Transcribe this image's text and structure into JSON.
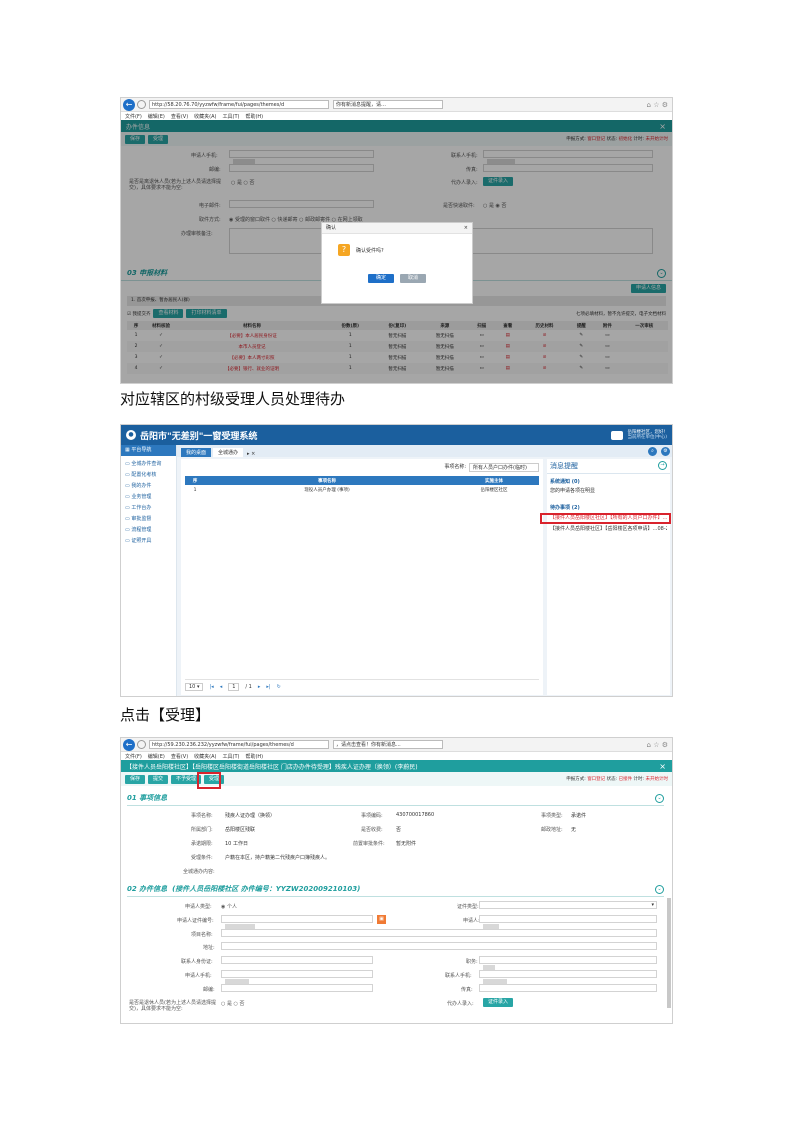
{
  "screen1": {
    "url": "http://58.20.76.70/yyzwfw/frame/fui/pages/themes/d",
    "tab_title": "你有新消息提醒，请…",
    "menu": [
      "文件(F)",
      "编辑(E)",
      "查看(V)",
      "收藏夹(A)",
      "工具(T)",
      "帮助(H)"
    ],
    "window_title": "办件信息",
    "close": "×",
    "buttons": [
      "保存",
      "受理"
    ],
    "status": {
      "label_method": "申报方式:",
      "method": "窗口登记",
      "label_state": "状态:",
      "state": "初始化",
      "label_timer": "计时:",
      "timer": "未开始计时"
    },
    "form_labels": {
      "mobile": "申请人手机:",
      "postal": "邮编:",
      "is_pension": "是否是离退休人员(若为上述人员请选择提交)，具体要求不能为空:",
      "yes": "是",
      "no": "否",
      "email": "电子邮件:",
      "pickup": "取件方式:",
      "pickup_options": [
        "受理的窗口取件",
        "快递邮寄",
        "邮政邮寄件",
        "在网上领取"
      ],
      "remark": "办理审核备注:",
      "contact_mobile": "联系人手机:",
      "fax": "传真:",
      "agent_entry": "代办人录入:",
      "agent_btn": "证件录入",
      "express": "是否快递取件:",
      "express_yes": "是",
      "express_no": "否"
    },
    "dialog": {
      "title": "确认",
      "message": "确认受件吗?",
      "ok": "确定",
      "cancel": "取消"
    },
    "section_title": "03 申报材料",
    "right_btn": "申请人信息",
    "material_group": "1. 首次申报、暂办居民人(群)",
    "toolbar": {
      "check_all": "我提交齐",
      "scan_btn": "查看材料",
      "print_btn": "打印材料清单",
      "note": "七项必填材料，暂不允许提交，电子文档材料"
    },
    "columns": [
      "序",
      "材料核验",
      "材料名称",
      "份数(原)",
      "份(复印)",
      "来源",
      "扫描",
      "查看",
      "历史材料",
      "提醒",
      "附件",
      "一次审核"
    ],
    "rows": [
      {
        "no": "1",
        "check": "✓",
        "name": "【必要】本人居民身份证",
        "qty": "1",
        "copy": "暂无扫描",
        "src": "暂无扫描"
      },
      {
        "no": "2",
        "check": "✓",
        "name": "本市人员登记",
        "qty": "1",
        "copy": "暂无扫描",
        "src": "暂无扫描"
      },
      {
        "no": "3",
        "check": "✓",
        "name": "【必要】本人两寸彩照",
        "qty": "1",
        "copy": "暂无扫描",
        "src": "暂无扫描"
      },
      {
        "no": "4",
        "check": "✓",
        "name": "【必要】银行、就业的证明",
        "qty": "1",
        "copy": "暂无扫描",
        "src": "暂无扫描"
      }
    ]
  },
  "caption1": "对应辖区的村级受理人员处理待办",
  "screen2": {
    "system_name": "岳阳市\"无差别\"一窗受理系统",
    "user_line1": "岳阳楼社区，您好!",
    "user_line2": "当前所在单位(中心)",
    "nav_title": "平台导航",
    "nav_items": [
      "全城办件查询",
      "配置化考核",
      "我的办件",
      "业务管理",
      "工作台办",
      "审批监督",
      "流程管理",
      "证照开具"
    ],
    "tabs": [
      "我的桌面",
      "全城通办"
    ],
    "search_label": "事项名称:",
    "search_value": "所有人员户口办件(临时)",
    "columns": [
      "序",
      "事项名称",
      "实施主体"
    ],
    "rows": [
      {
        "no": "1",
        "name": "现役人员户办理 (事项)",
        "org": "岳阳楼区社区"
      }
    ],
    "pager": {
      "size": "10",
      "page": "1",
      "of": "/ 1"
    },
    "msg_title": "消息提醒",
    "notice_title": "系统通知 (0)",
    "notice_item": "您的申请各项在明显",
    "todo_title": "待办事项 (2)",
    "todo_items": [
      "【接件人员岳阳楼区社区】【所有的人员户口办件】…08-21",
      "【接件人员岳阳楼社区】【岳阳楼区各项申请】…08-21"
    ]
  },
  "caption2": "点击【受理】",
  "screen3": {
    "url": "http://59.230.236.232/yyzwfw/frame/fui/pages/themes/d",
    "tab_title": "，请点击查看！你有新消息...",
    "menu": [
      "文件(F)",
      "编辑(E)",
      "查看(V)",
      "收藏夹(A)",
      "工具(T)",
      "帮助(H)"
    ],
    "window_title": "【接件人员岳阳楼社区】【岳阳楼区岳阳楼街道岳阳楼社区 门店办办件待受理】残疾人证办理（换领）(李蔚民)",
    "buttons": [
      "保存",
      "提交",
      "不予受理",
      "受理"
    ],
    "status": {
      "label_method": "申报方式:",
      "method": "窗口登记",
      "label_state": "状态:",
      "state": "已接件",
      "label_timer": "计时:",
      "timer": "未开始计时"
    },
    "section1": "01 事项信息",
    "info": [
      {
        "label": "事项名称:",
        "value": "残疾人证办理（换领）"
      },
      {
        "label": "所属部门:",
        "value": "岳阳楼区残联"
      },
      {
        "label": "承诺期限:",
        "value": "10 工作日"
      },
      {
        "label": "受理条件:",
        "value": "户籍在本区，持户籍第二代残疾户口簿残疾人。"
      },
      {
        "label": "全城通办内容:",
        "value": ""
      }
    ],
    "info_right": [
      {
        "label": "事项编码:",
        "value": "430700017860"
      },
      {
        "label": "是否收费:",
        "value": "否"
      },
      {
        "label": "前置审批条件:",
        "value": "暂无附件"
      }
    ],
    "info_far": [
      {
        "label": "事项类型:",
        "value": "承诺件"
      },
      {
        "label": "邮政地址:",
        "value": "无"
      }
    ],
    "section2_prefix": "02 办件信息",
    "section2_detail": "(接件人员岳阳楼社区 办件编号：YYZW202009210103)",
    "form": {
      "applicant_type": "申请人类型:",
      "applicant_type_value": "个人",
      "id_type": "申请人证件编号:",
      "project": "项目名称:",
      "address": "地址:",
      "contact_id": "联系人身份证:",
      "applicant_phone": "申请人手机:",
      "postal": "邮编:",
      "is_pension": "是否是退休人员(若为上述人员请选择提交)，具体要求不能为空:",
      "yes": "是",
      "no": "否",
      "cert_type": "证件类型:",
      "applicant": "申请人:",
      "job": "职务:",
      "contact_mobile": "联系人手机:",
      "fax": "传真:",
      "agent": "代办人录入:",
      "agent_btn": "证件录入"
    }
  }
}
